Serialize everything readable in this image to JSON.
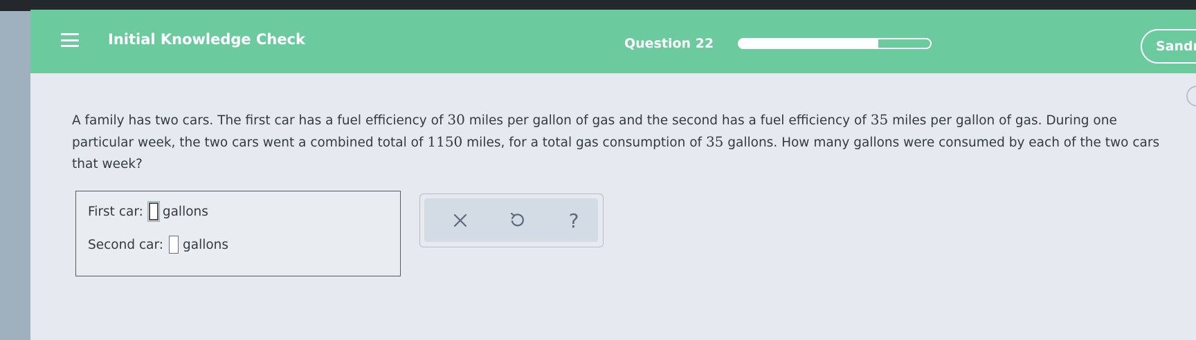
{
  "header": {
    "title": "Initial Knowledge Check",
    "question_label": "Question 22",
    "progress_fraction": 0.73,
    "user_name": "Sandr"
  },
  "problem": {
    "p1": "A family has two cars. The first car has a fuel efficiency of ",
    "n1": "30",
    "p2": " miles per gallon of gas and the second has a fuel efficiency of ",
    "n2": "35",
    "p3": " miles per gallon of gas. During one particular week, the two cars went a combined total of ",
    "n3": "1150",
    "p4": " miles, for a total gas consumption of ",
    "n4": "35",
    "p5": " gallons. How many gallons were consumed by each of the two cars that week?"
  },
  "answers": {
    "first_label": "First car:",
    "first_value": "",
    "second_label": "Second car:",
    "second_value": "",
    "unit": "gallons"
  },
  "tools": {
    "clear_icon": "x-icon",
    "undo_icon": "undo-icon",
    "help_icon": "question-icon",
    "help_glyph": "?"
  },
  "colors": {
    "header_green": "#6bcb9f",
    "page_background": "#e6eaf0",
    "tool_icon": "#5b6a7a"
  }
}
